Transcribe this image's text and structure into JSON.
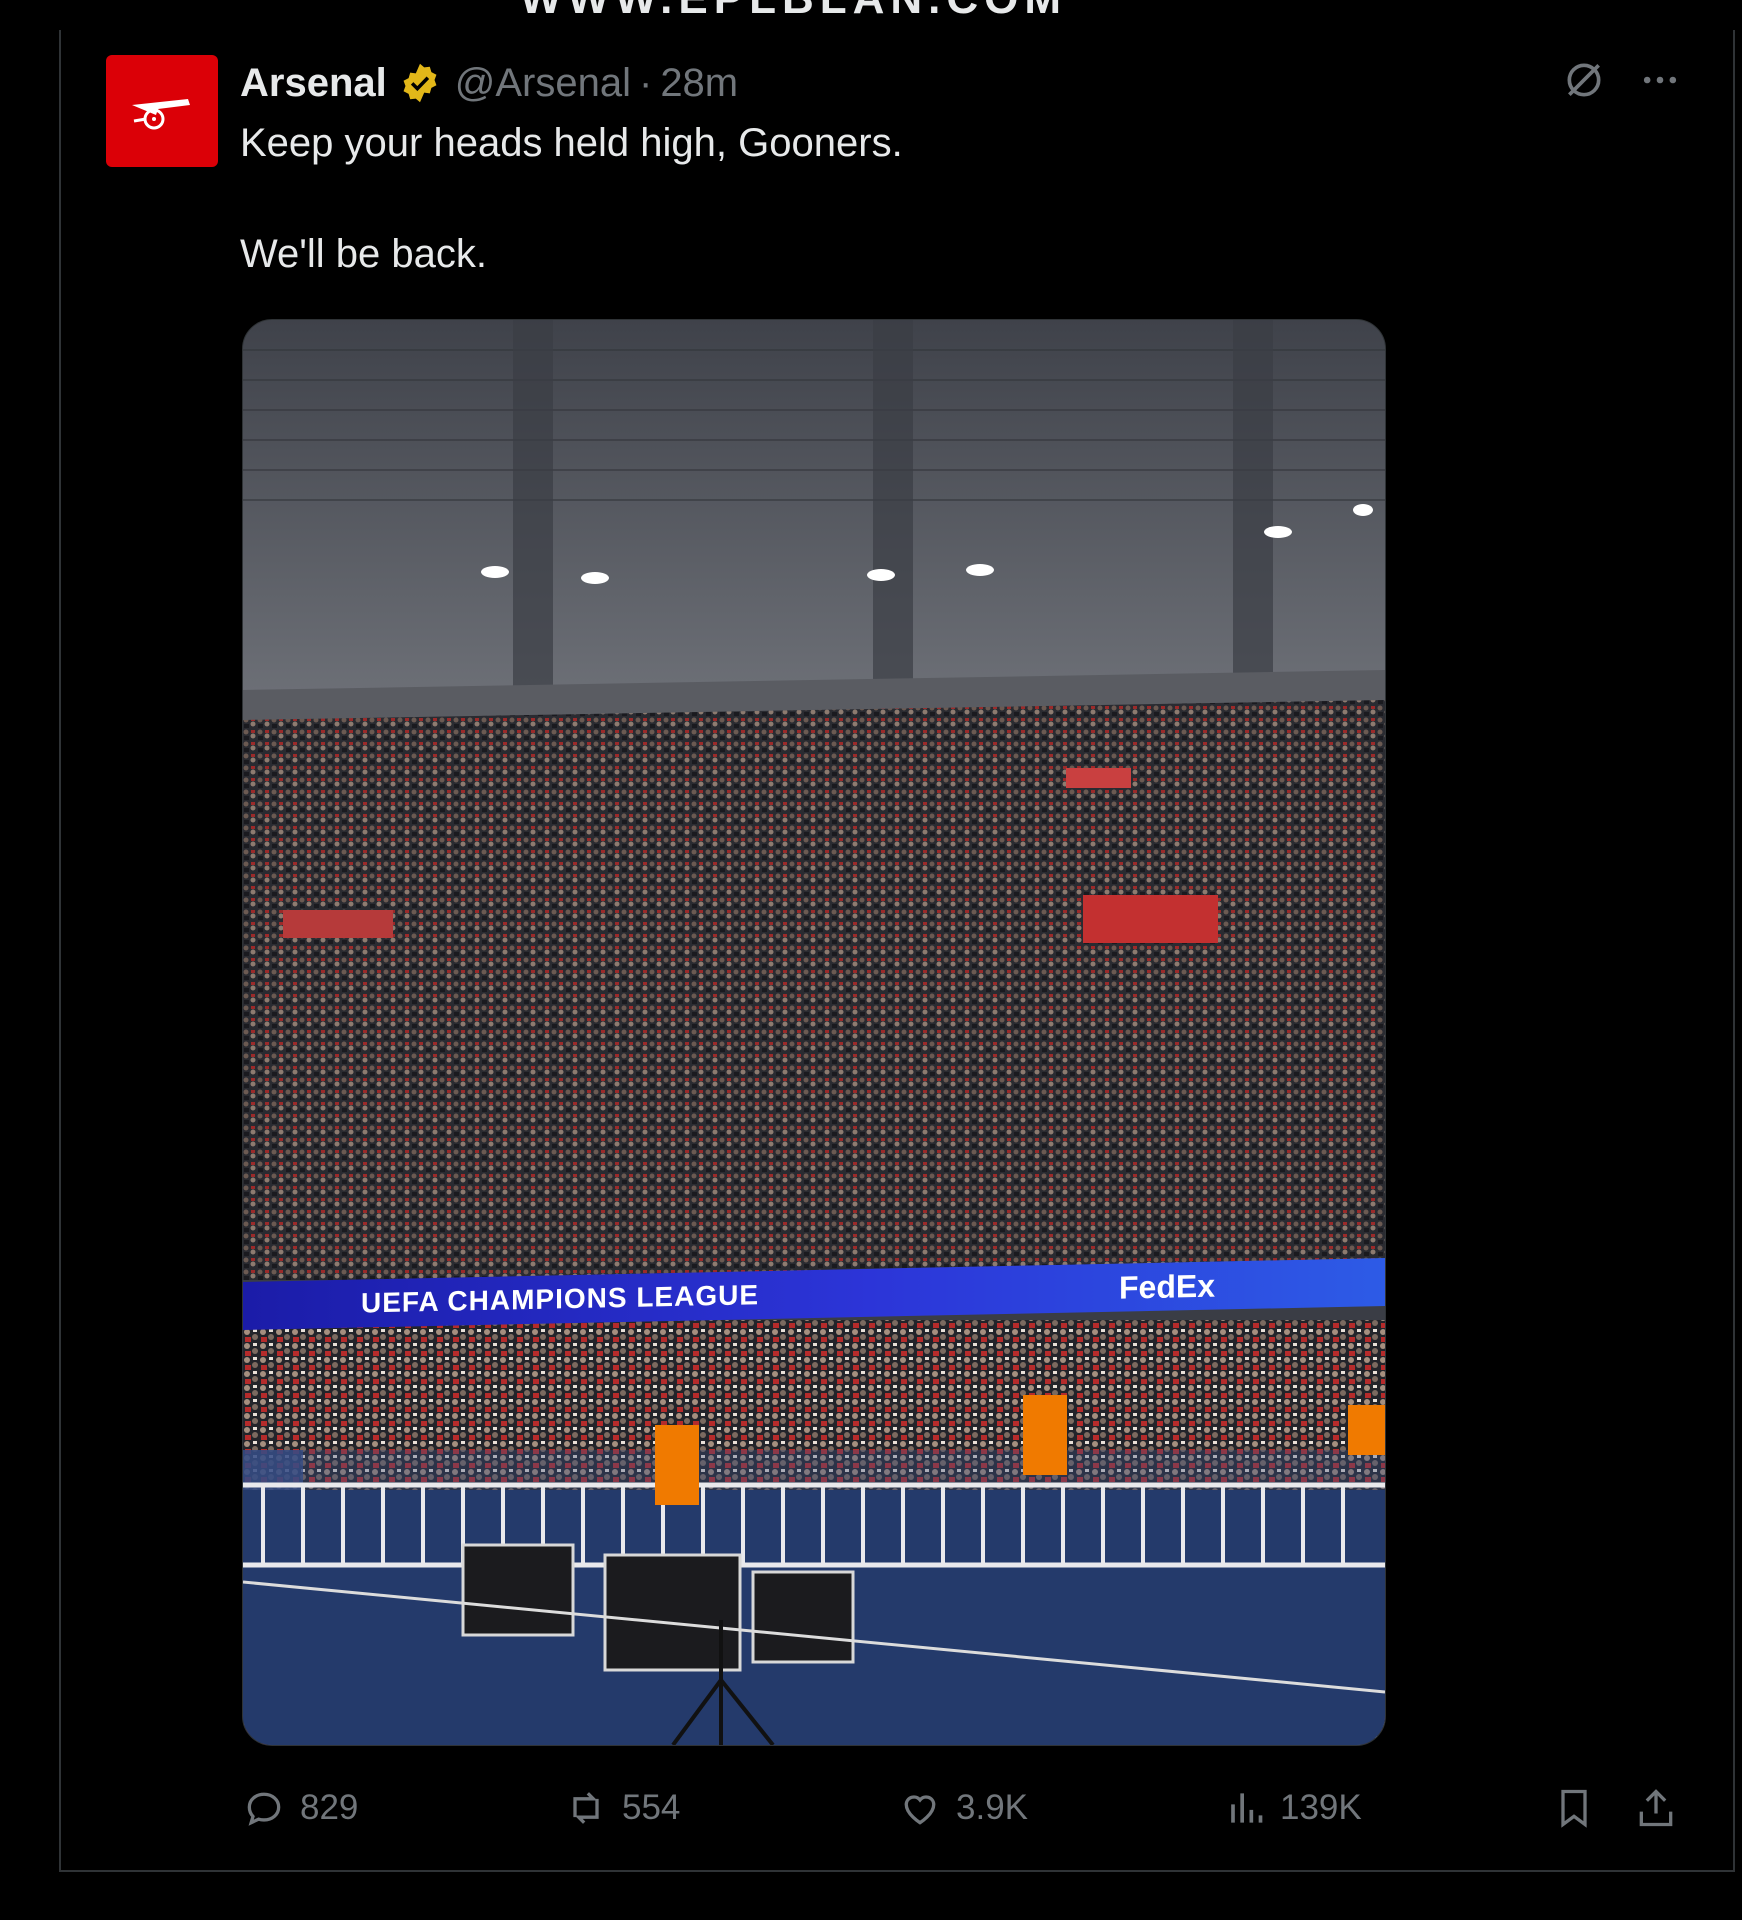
{
  "tweet": {
    "author_name": "Arsenal",
    "handle": "@Arsenal",
    "separator": "·",
    "time": "28m",
    "text_lines": [
      "Keep your heads held high, Gooners.",
      "We'll be back."
    ],
    "media": {
      "board_text": "UEFA CHAMPIONS LEAGUE",
      "sponsor_text": "FedEx"
    },
    "stats": {
      "replies": "829",
      "reposts": "554",
      "likes": "3.9K",
      "views": "139K"
    }
  },
  "icons": {
    "verified": "verified-badge-icon",
    "grok": "grok-icon",
    "more": "more-icon",
    "reply": "reply-icon",
    "repost": "repost-icon",
    "like": "like-icon",
    "views": "views-icon",
    "bookmark": "bookmark-icon",
    "share": "share-icon"
  },
  "colors": {
    "background": "#000000",
    "text": "#e7e9ea",
    "secondary": "#71767b",
    "brand_red": "#db0007",
    "verified_gold": "#e2b719"
  }
}
